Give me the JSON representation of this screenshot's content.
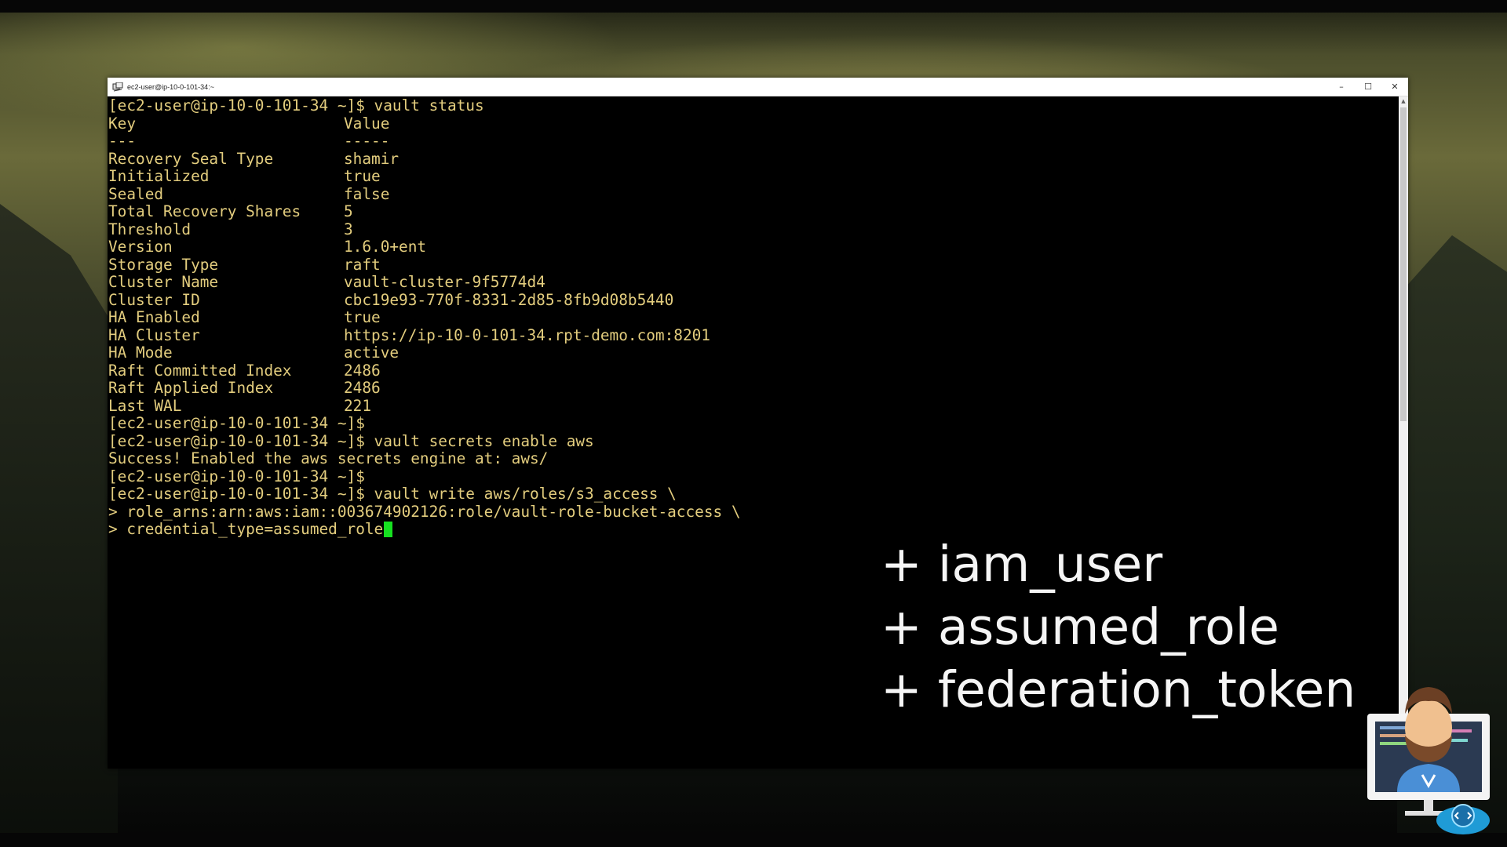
{
  "window": {
    "title": "ec2-user@ip-10-0-101-34:~",
    "minimize_glyph": "–",
    "maximize_glyph": "☐",
    "close_glyph": "✕"
  },
  "terminal": {
    "cursor_color": "#16e020",
    "text_color": "#e3cd7e",
    "lines": [
      {
        "text": "[ec2-user@ip-10-0-101-34 ~]$ vault status"
      },
      {
        "key": "Key",
        "value": "Value"
      },
      {
        "key": "---",
        "value": "-----"
      },
      {
        "key": "Recovery Seal Type",
        "value": "shamir"
      },
      {
        "key": "Initialized",
        "value": "true"
      },
      {
        "key": "Sealed",
        "value": "false"
      },
      {
        "key": "Total Recovery Shares",
        "value": "5"
      },
      {
        "key": "Threshold",
        "value": "3"
      },
      {
        "key": "Version",
        "value": "1.6.0+ent"
      },
      {
        "key": "Storage Type",
        "value": "raft"
      },
      {
        "key": "Cluster Name",
        "value": "vault-cluster-9f5774d4"
      },
      {
        "key": "Cluster ID",
        "value": "cbc19e93-770f-8331-2d85-8fb9d08b5440"
      },
      {
        "key": "HA Enabled",
        "value": "true"
      },
      {
        "key": "HA Cluster",
        "value": "https://ip-10-0-101-34.rpt-demo.com:8201"
      },
      {
        "key": "HA Mode",
        "value": "active"
      },
      {
        "key": "Raft Committed Index",
        "value": "2486"
      },
      {
        "key": "Raft Applied Index",
        "value": "2486"
      },
      {
        "key": "Last WAL",
        "value": "221"
      },
      {
        "text": "[ec2-user@ip-10-0-101-34 ~]$"
      },
      {
        "text": "[ec2-user@ip-10-0-101-34 ~]$ vault secrets enable aws"
      },
      {
        "text": "Success! Enabled the aws secrets engine at: aws/"
      },
      {
        "text": "[ec2-user@ip-10-0-101-34 ~]$"
      },
      {
        "text": "[ec2-user@ip-10-0-101-34 ~]$ vault write aws/roles/s3_access \\"
      },
      {
        "text": "> role_arns:arn:aws:iam::003674902126:role/vault-role-bucket-access \\"
      },
      {
        "text": "> credential_type=assumed_role",
        "cursor": true
      }
    ]
  },
  "overlay": {
    "items": [
      "+ iam_user",
      "+ assumed_role",
      "+ federation_token"
    ]
  }
}
